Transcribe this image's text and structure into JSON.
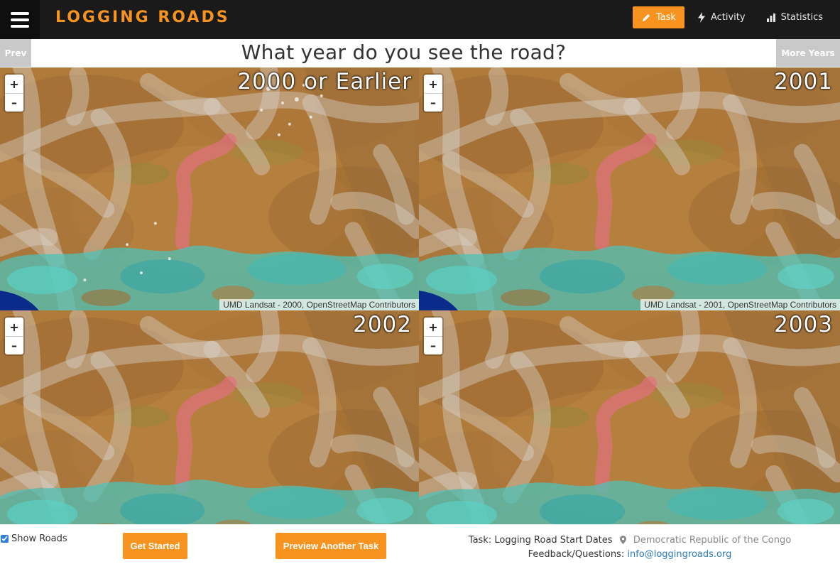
{
  "header": {
    "brand": "LOGGING ROADS",
    "nav": [
      {
        "label": "Task",
        "icon": "pencil-icon",
        "active": true
      },
      {
        "label": "Activity",
        "icon": "lightning-icon",
        "active": false
      },
      {
        "label": "Statistics",
        "icon": "bar-chart-icon",
        "active": false
      }
    ]
  },
  "question_bar": {
    "prev_label": "Prev",
    "question": "What year do you see the road?",
    "more_label": "More Years"
  },
  "maps": [
    {
      "year_label": "2000 or Earlier",
      "attribution": "UMD Landsat - 2000, OpenStreetMap Contributors"
    },
    {
      "year_label": "2001",
      "attribution": "UMD Landsat - 2001, OpenStreetMap Contributors"
    },
    {
      "year_label": "2002",
      "attribution": ""
    },
    {
      "year_label": "2003",
      "attribution": ""
    }
  ],
  "zoom": {
    "in": "+",
    "out": "–"
  },
  "footer": {
    "show_roads_label": "Show Roads",
    "show_roads_checked": true,
    "get_started_label": "Get Started",
    "preview_task_label": "Preview Another Task",
    "task_label": "Task: Logging Road Start Dates",
    "country": "Democratic Republic of the Congo",
    "feedback_label": "Feedback/Questions:",
    "feedback_email": "info@loggingroads.org"
  },
  "colors": {
    "accent": "#f7931e",
    "header_bg": "#1a1a1a",
    "link": "#2a7ab8",
    "highlight_road": "#e0707f"
  }
}
